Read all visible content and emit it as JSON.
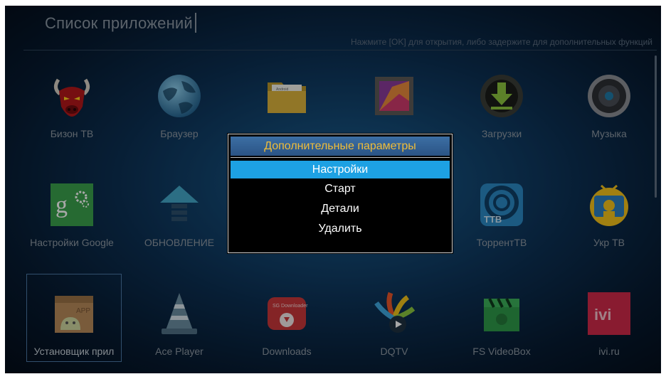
{
  "header": {
    "title": "Список приложений",
    "hint": "Нажмите [OK] для открытия, либо задержите для дополнительных функций"
  },
  "apps": [
    {
      "label": "Бизон ТВ",
      "icon": "bison-tv-icon"
    },
    {
      "label": "Браузер",
      "icon": "globe-icon"
    },
    {
      "label": "",
      "icon": "folder-icon"
    },
    {
      "label": "",
      "icon": "gallery-icon"
    },
    {
      "label": "Загрузки",
      "icon": "download-icon"
    },
    {
      "label": "Музыка",
      "icon": "speaker-icon"
    },
    {
      "label": "Настройки Google",
      "icon": "google-settings-icon"
    },
    {
      "label": "ОБНОВЛЕНИЕ",
      "icon": "update-arrow-icon"
    },
    {
      "label": "",
      "icon": "hidden-app-icon"
    },
    {
      "label": "",
      "icon": "video-player-icon"
    },
    {
      "label": "ТоррентТВ",
      "icon": "torrent-tv-icon"
    },
    {
      "label": "Укр ТВ",
      "icon": "ukr-tv-icon"
    },
    {
      "label": "Установщик прил",
      "icon": "app-installer-icon"
    },
    {
      "label": "Ace Player",
      "icon": "cone-icon"
    },
    {
      "label": "Downloads",
      "icon": "sg-downloader-icon"
    },
    {
      "label": "DQTV",
      "icon": "dqtv-icon"
    },
    {
      "label": "FS VideoBox",
      "icon": "clapperboard-icon"
    },
    {
      "label": "ivi.ru",
      "icon": "ivi-icon"
    }
  ],
  "app_icon_texts": {
    "folder": "Android\nfile management",
    "torrent": "ТТВ",
    "installer": "APP",
    "sg": "SG Downloader",
    "ivi": "ivi"
  },
  "dialog": {
    "title": "Дополнительные параметры",
    "items": [
      "Настройки",
      "Старт",
      "Детали",
      "Удалить"
    ],
    "active_index": 0
  },
  "colors": {
    "dialog_title_text": "#f0bd3a",
    "active_item_bg": "#1da1e3",
    "background": "#0c2f52"
  }
}
